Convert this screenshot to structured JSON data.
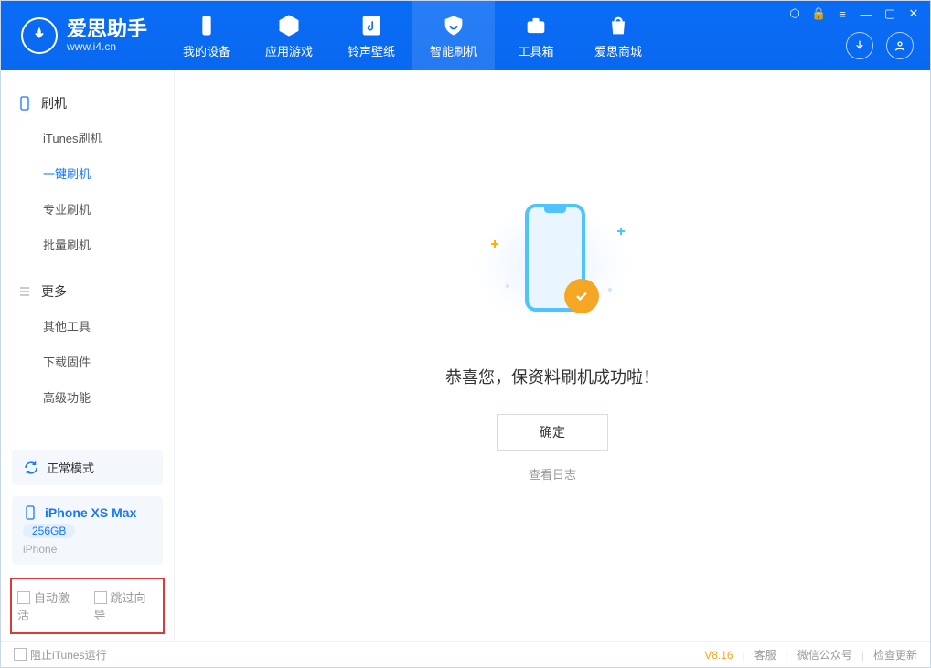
{
  "app": {
    "title": "爱思助手",
    "subtitle": "www.i4.cn"
  },
  "nav": {
    "mydevice": "我的设备",
    "appgame": "应用游戏",
    "ringtone": "铃声壁纸",
    "flash": "智能刷机",
    "toolbox": "工具箱",
    "store": "爱思商城"
  },
  "sidebar": {
    "group_flash": "刷机",
    "itunes": "iTunes刷机",
    "oneclick": "一键刷机",
    "pro": "专业刷机",
    "batch": "批量刷机",
    "group_more": "更多",
    "other": "其他工具",
    "firmware": "下载固件",
    "advanced": "高级功能"
  },
  "mode": {
    "label": "正常模式"
  },
  "device": {
    "name": "iPhone XS Max",
    "capacity": "256GB",
    "type": "iPhone"
  },
  "options": {
    "auto_activate": "自动激活",
    "skip_guide": "跳过向导"
  },
  "result": {
    "message": "恭喜您，保资料刷机成功啦！",
    "ok": "确定",
    "viewlog": "查看日志"
  },
  "footer": {
    "block_itunes": "阻止iTunes运行",
    "version": "V8.16",
    "support": "客服",
    "wechat": "微信公众号",
    "update": "检查更新"
  }
}
